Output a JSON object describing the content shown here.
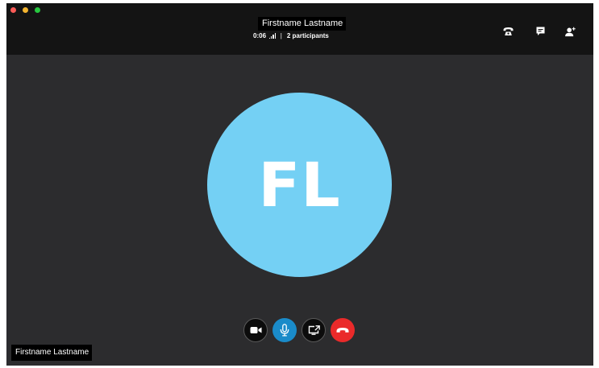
{
  "window": {
    "traffic_lights": [
      "close",
      "minimize",
      "zoom"
    ]
  },
  "header": {
    "caller_name": "Firstname Lastname",
    "duration": "0:06",
    "signal_icon": "signal-strength-icon",
    "separator": "|",
    "participants": "2 participants",
    "actions": [
      {
        "name": "dialpad",
        "icon": "phone-icon"
      },
      {
        "name": "chat",
        "icon": "chat-icon"
      },
      {
        "name": "add-participant",
        "icon": "add-person-icon"
      }
    ]
  },
  "stage": {
    "avatar_initials": "FL",
    "avatar_color": "#74d0f4"
  },
  "controls": [
    {
      "name": "video",
      "icon": "video-camera-icon",
      "color": "#0c0c0c"
    },
    {
      "name": "mute",
      "icon": "microphone-icon",
      "color": "#1a8bc9"
    },
    {
      "name": "share-screen",
      "icon": "share-screen-icon",
      "color": "#0c0c0c"
    },
    {
      "name": "end-call",
      "icon": "hang-up-icon",
      "color": "#ea2a2a"
    }
  ],
  "self_view": {
    "label": "Firstname Lastname"
  }
}
